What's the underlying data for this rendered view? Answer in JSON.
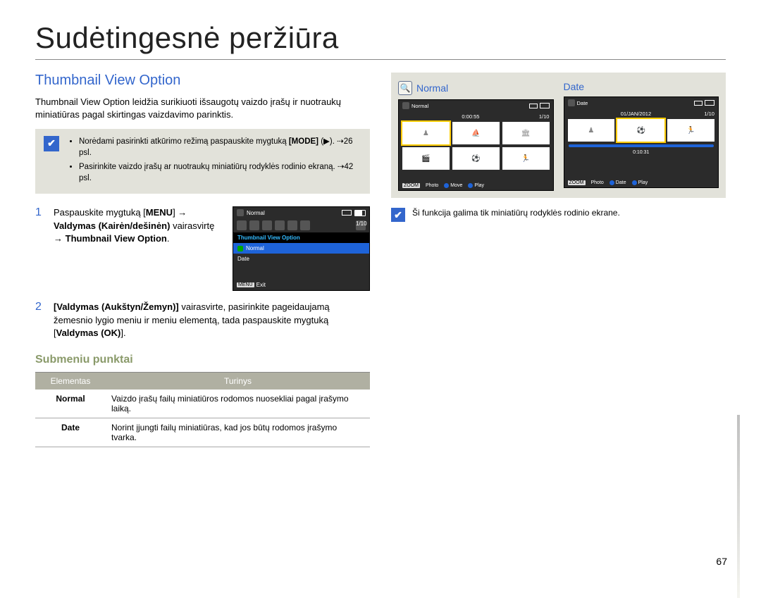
{
  "page": {
    "title": "Sudėtingesnė peržiūra",
    "number": "67"
  },
  "section": {
    "title": "Thumbnail View Option",
    "intro": "Thumbnail View Option leidžia surikiuoti išsaugotų vaizdo įrašų ir nuotraukų miniatiūras pagal skirtingas vaizdavimo parinktis."
  },
  "tips": {
    "bullet1_a": "Norėdami pasirinkti atkūrimo režimą paspauskite mygtuką ",
    "bullet1_mode": "[MODE]",
    "bullet1_b": " (▶). ⇢26 psl.",
    "bullet2": "Pasirinkite vaizdo įrašų ar nuotraukų miniatiūrų rodyklės rodinio ekraną. ⇢42 psl."
  },
  "steps": {
    "s1_a": "Paspauskite mygtuką [",
    "s1_menu": "MENU",
    "s1_b": "] → ",
    "s1_control": "Valdymas (Kairėn/dešinėn)",
    "s1_c": " vairasvirtę → ",
    "s1_tvo": "Thumbnail View Option",
    "s1_d": ".",
    "s2_control": "Valdymas (Aukštyn/Žemyn)",
    "s2_body": " vairasvirte, pasirinkite pageidaujamą žemesnio lygio meniu ir meniu elementą, tada paspauskite mygtuką [",
    "s2_ok": "Valdymas (OK)",
    "s2_end": "]."
  },
  "menu_screen": {
    "top_label": "Normal",
    "counter": "1/10",
    "header": "Thumbnail View Option",
    "item_normal": "Normal",
    "item_date": "Date",
    "exit_btn": "MENU",
    "exit_lbl": "Exit"
  },
  "submenu": {
    "title": "Submeniu punktai",
    "th_element": "Elementas",
    "th_content": "Turinys",
    "row1_name": "Normal",
    "row1_desc": "Vaizdo įrašų failų miniatiūros rodomos nuosekliai pagal įrašymo laiką.",
    "row2_name": "Date",
    "row2_desc": "Norint įjungti failų miniatiūras, kad jos būtų rodomos įrašymo tvarka."
  },
  "previews": {
    "normal": {
      "label": "Normal",
      "hdr_text": "Normal",
      "time": "0:00:55",
      "counter": "1/10",
      "footer_zoom": "ZOOM",
      "footer_photo": "Photo",
      "footer_move": "Move",
      "footer_play": "Play"
    },
    "date": {
      "label": "Date",
      "hdr_text": "Date",
      "date_text": "01/JAN/2012",
      "counter": "1/10",
      "time_mid": "0:10:31",
      "footer_zoom": "ZOOM",
      "footer_photo": "Photo",
      "footer_date": "Date",
      "footer_play": "Play"
    }
  },
  "note": "Ši funkcija galima tik miniatiūrų rodyklės rodinio ekrane."
}
